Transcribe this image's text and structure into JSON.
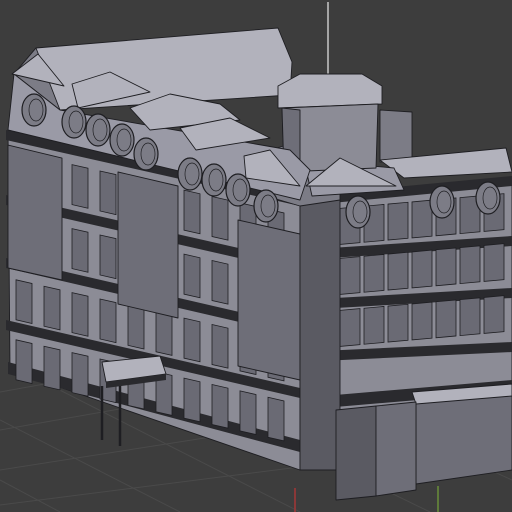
{
  "viewport": {
    "kind": "3d-model-viewport",
    "shading": "solid-with-wireframe",
    "subject": "multi-storey-building-model"
  },
  "colors": {
    "background": "#3d3d3d",
    "grid_line": "#4a4a4a",
    "grid_axis_red": "#8a3838",
    "grid_axis_green": "#5e7a3a",
    "roof": "#9a9aa6",
    "roof_light": "#b2b2bc",
    "roof_dark": "#7c7c86",
    "wall": "#8c8c96",
    "wall_dark": "#6e6e78",
    "wall_shadow": "#5a5a62",
    "window": "#6a6a74",
    "cornice": "#2a2a2e",
    "wire": "#1e1e22",
    "antenna": "#c8c8c8"
  },
  "icons": {
    "dormer": "round-porthole-dormer-icon",
    "chimney": "tower-chimney-icon",
    "canopy": "entrance-canopy-icon"
  }
}
